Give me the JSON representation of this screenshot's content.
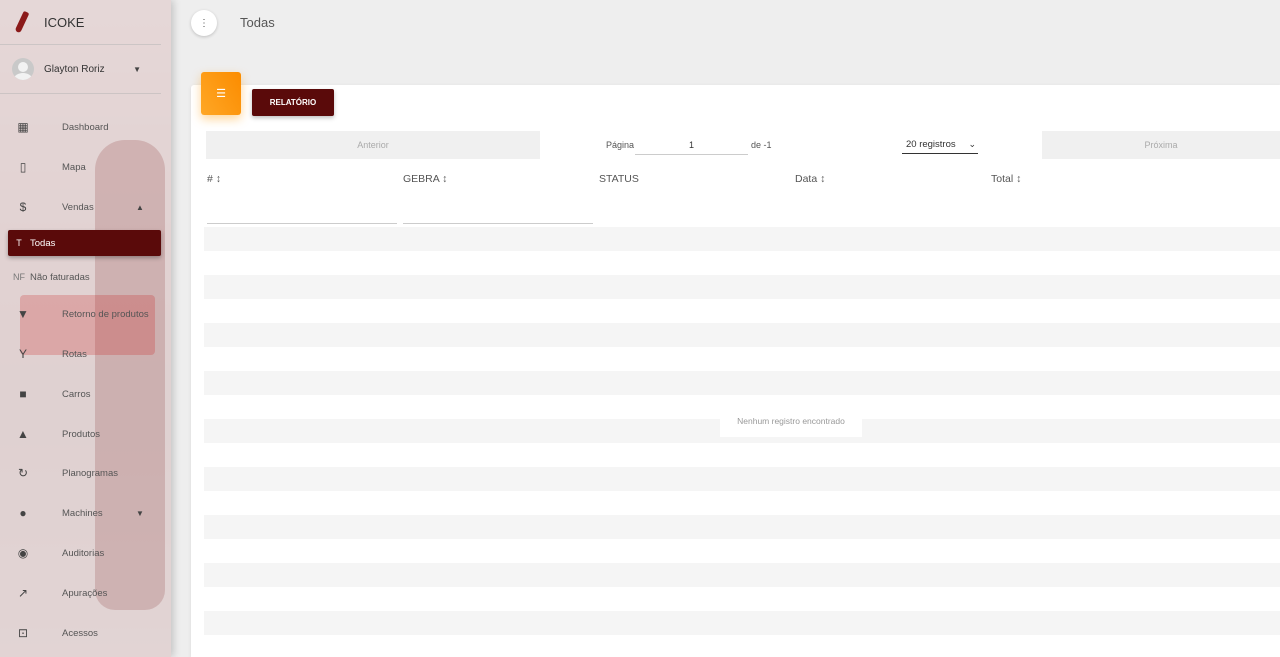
{
  "app": {
    "name": "ICOKE"
  },
  "user": {
    "name": "Glayton Roriz"
  },
  "sidebar": {
    "items": [
      {
        "label": "Dashboard",
        "icon": "dashboard-icon"
      },
      {
        "label": "Mapa",
        "icon": "map-icon"
      },
      {
        "label": "Vendas",
        "icon": "dollar-icon"
      },
      {
        "label": "Retorno de produtos",
        "icon": "thumb-down-icon"
      },
      {
        "label": "Rotas",
        "icon": "route-icon"
      },
      {
        "label": "Carros",
        "icon": "truck-icon"
      },
      {
        "label": "Produtos",
        "icon": "shapes-icon"
      },
      {
        "label": "Planogramas",
        "icon": "sync-icon"
      },
      {
        "label": "Machines",
        "icon": "pin-icon"
      },
      {
        "label": "Auditorias",
        "icon": "eye-icon"
      },
      {
        "label": "Apurações",
        "icon": "trending-icon"
      },
      {
        "label": "Acessos",
        "icon": "lock-icon"
      }
    ],
    "sub_items": [
      {
        "abbr": "T",
        "label": "Todas"
      },
      {
        "abbr": "NF",
        "label": "Não faturadas"
      }
    ]
  },
  "header": {
    "title": "Todas"
  },
  "toolbar": {
    "report_label": "RELATÓRIO"
  },
  "pagination": {
    "prev_label": "Anterior",
    "next_label": "Próxima",
    "page_label": "Página",
    "page_value": "1",
    "of_label": "de -1",
    "page_size": "20 registros"
  },
  "table": {
    "columns": [
      "# ↕",
      "GEBRA ↕",
      "STATUS",
      "Data ↕",
      "Total ↕"
    ],
    "empty_message": "Nenhum registro encontrado"
  },
  "colors": {
    "primary": "#5a0a0a",
    "accent": "#fb8c00"
  }
}
